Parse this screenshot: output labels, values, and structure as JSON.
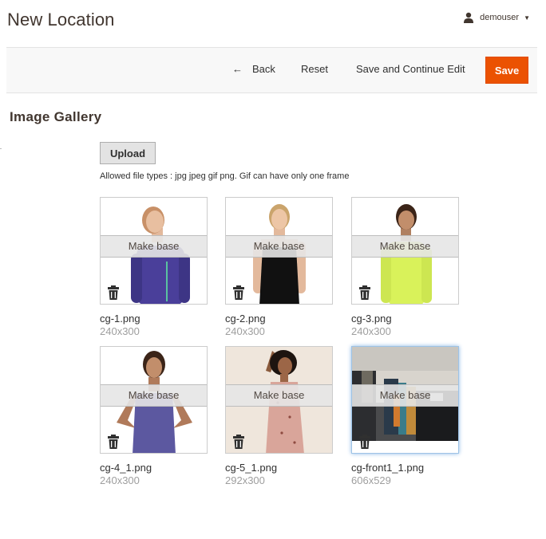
{
  "header": {
    "title": "New Location",
    "user": {
      "name": "demouser",
      "icon": "user-icon"
    }
  },
  "actions": {
    "back_label": "Back",
    "reset_label": "Reset",
    "save_continue_label": "Save and Continue Edit",
    "save_label": "Save",
    "save_color": "#eb5202"
  },
  "gallery": {
    "title": "Image Gallery",
    "upload_label": "Upload",
    "allowed_note": "Allowed file types : jpg jpeg gif png. Gif can have only one frame",
    "make_base_label": "Make base",
    "images": [
      {
        "filename": "cg-1.png",
        "dimensions": "240x300",
        "garment_color": "#4a3f9a"
      },
      {
        "filename": "cg-2.png",
        "dimensions": "240x300",
        "garment_color": "#111111"
      },
      {
        "filename": "cg-3.png",
        "dimensions": "240x300",
        "garment_color": "#d9f25a"
      },
      {
        "filename": "cg-4_1.png",
        "dimensions": "240x300",
        "garment_color": "#5c58a0"
      },
      {
        "filename": "cg-5_1.png",
        "dimensions": "292x300",
        "garment_color": "#d9a59a"
      },
      {
        "filename": "cg-front1_1.png",
        "dimensions": "606x529",
        "selected": true
      }
    ]
  }
}
